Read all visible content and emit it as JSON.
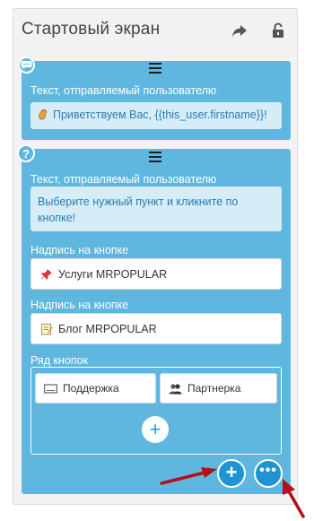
{
  "screen": {
    "title": "Стартовый экран",
    "header_icons": [
      "share-icon",
      "unlock-icon"
    ]
  },
  "cards": [
    {
      "type_icon": "chat-bubble-icon",
      "text_label": "Текст, отправляемый пользователю",
      "message": "Приветствуем Вас, {{this_user.firstname}}!",
      "message_icon": "waving-hand-icon"
    },
    {
      "type_icon": "question-icon",
      "badge_glyph": "?",
      "text_label": "Текст, отправляемый пользователю",
      "message": "Выберите нужный пункт и кликните по кнопке!",
      "button_caption_label": "Надпись на кнопке",
      "buttons": [
        {
          "icon": "pushpin-icon",
          "label": "Услуги MRPOPULAR"
        },
        {
          "icon": "memo-icon",
          "label": "Блог MRPOPULAR"
        }
      ],
      "row_label": "Ряд кнопок",
      "row_buttons": [
        {
          "icon": "keyboard-icon",
          "label": "Поддержка"
        },
        {
          "icon": "people-icon",
          "label": "Партнерка"
        }
      ],
      "add_glyph": "+"
    }
  ],
  "fab": {
    "add_glyph": "+",
    "more_glyph": "•••"
  },
  "colors": {
    "card": "#5fb7e0",
    "message_bg": "#d6edf8",
    "message_text": "#2a7cb0",
    "fab": "#1f94d2",
    "annotation_arrow": "#b3121b"
  }
}
